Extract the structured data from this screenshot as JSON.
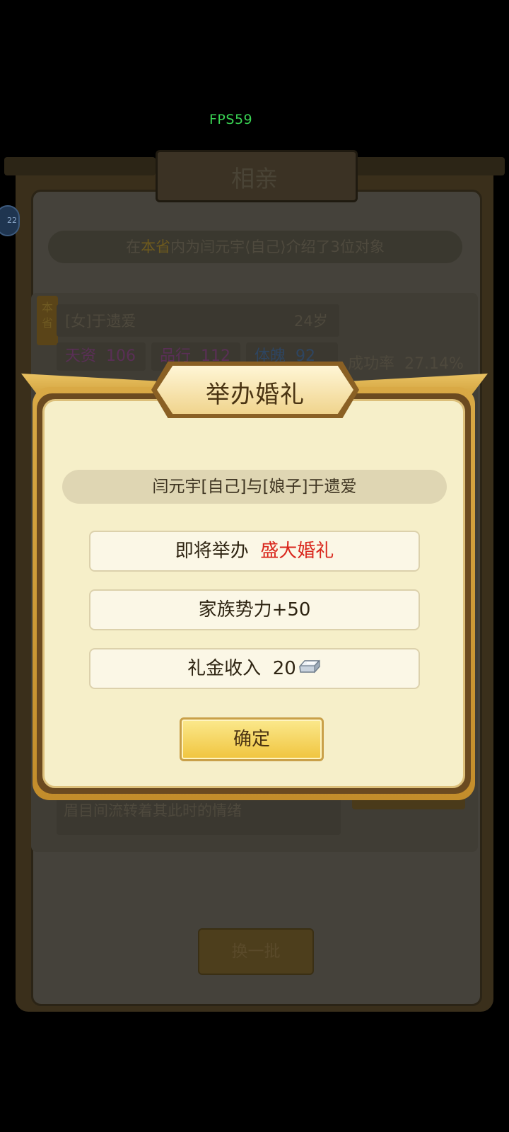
{
  "status": {
    "fps": "FPS59"
  },
  "background": {
    "title": "相亲",
    "avatar_badge": "22",
    "info": {
      "prefix": "在",
      "place": "本省",
      "middle": "内为闫元宇",
      "self": "自己",
      "suffix": "介绍了3位对象"
    },
    "candidate": {
      "tag": "本省",
      "name": "[女]于遗爱",
      "age": "24岁",
      "stats": [
        {
          "label": "天资",
          "value": "106"
        },
        {
          "label": "品行",
          "value": "112"
        },
        {
          "label": "体魄",
          "value": "92"
        }
      ],
      "success_rate_label": "成功率",
      "success_rate": "27.14%",
      "description": "眉目间流转着其此时的情绪"
    },
    "refresh_label": "换一批"
  },
  "dialog": {
    "title": "举办婚礼",
    "couple": "闫元宇[自己]与[娘子]于遗爱",
    "wedding_prefix": "即将举办",
    "wedding_type": "盛大婚礼",
    "clan_power": "家族势力+50",
    "gift_label": "礼金收入",
    "gift_amount": "20",
    "gift_icon": "silver-ingot-icon",
    "confirm_label": "确定"
  },
  "colors": {
    "accent_red": "#d9261c",
    "gold": "#f0c43e",
    "panel": "#f6efc9"
  }
}
